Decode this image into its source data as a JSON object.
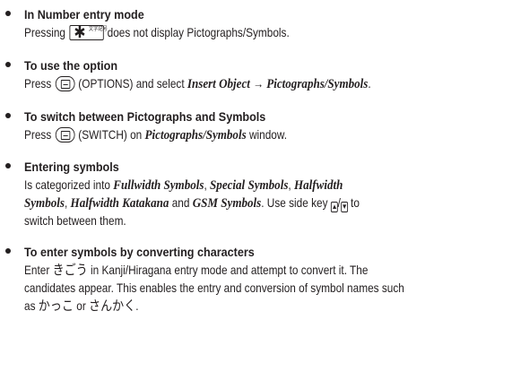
{
  "items": [
    {
      "heading": "In Number entry mode",
      "lines": [
        {
          "pre": "Pressing",
          "post": "does not display Pictographs/Symbols."
        }
      ],
      "key_label": "文字記号"
    },
    {
      "heading": "To use the option",
      "lines": [
        {
          "pre": "Press",
          "post": "(OPTIONS) and select",
          "em1": "Insert Object",
          "arrow": "→",
          "em2": "Pictographs/Symbols",
          "end": "."
        }
      ]
    },
    {
      "heading": "To switch between Pictographs and Symbols",
      "lines": [
        {
          "pre": "Press",
          "post": "(SWITCH) on",
          "em1": "Pictographs/Symbols",
          "end": "window."
        }
      ]
    },
    {
      "heading": "Entering symbols",
      "lines": [
        {
          "t1": "Is categorized into",
          "e1": "Fullwidth Symbols",
          "t2": ",",
          "e2": "Special Symbols",
          "t3": ",",
          "e3": "Halfwidth"
        },
        {
          "e1": "Symbols",
          "t1": ",",
          "e2": "Halfwidth Katakana",
          "t2": "and",
          "e3": "GSM Symbols",
          "t3": ". Use side key"
        },
        {
          "t1": "switch between them."
        }
      ],
      "side_to": "to"
    },
    {
      "heading": "To enter symbols by converting characters",
      "lines": [
        {
          "t1": "Enter",
          "jp1": "きごう",
          "t2": "in Kanji/Hiragana entry mode and attempt to convert it. The"
        },
        {
          "t1": "candidates appear. This enables the entry and conversion of symbol names such"
        },
        {
          "t1": "as",
          "jp1": "かっこ",
          "t2": "or",
          "jp2": "さんかく",
          "t3": "."
        }
      ]
    }
  ]
}
